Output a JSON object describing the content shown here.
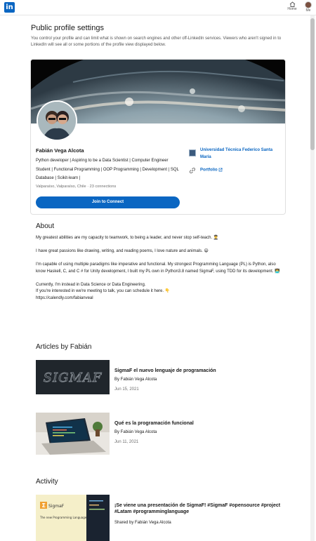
{
  "nav": {
    "logo_text": "in",
    "home_label": "Home",
    "me_label": "Me"
  },
  "settings": {
    "title": "Public profile settings",
    "description": "You control your profile and can limit what is shown on search engines and other off-LinkedIn services. Viewers who aren't signed in to LinkedIn will see all or some portions of the profile view displayed below."
  },
  "profile": {
    "name": "Fabián Vega Alcota",
    "headline": "Python developer | Aspiring to be a Data Scientist | Computer Engineer Student | Functional Programming | OOP Programming | Development | SQL Database | Scikit-learn |",
    "location": "Valparaíso, Valparaíso, Chile",
    "connections": "23 connections",
    "join_button": "Join to Connect",
    "education": "Universidad Técnica Federico Santa María",
    "portfolio_label": "Portfolio"
  },
  "about": {
    "title": "About",
    "paragraphs": [
      "My greatest abilities are my capacity to teamwork, to being a leader, and never stop self-teach. 👨‍🎓",
      "I have great passions like drawing, writing, and reading poems, I love nature and animals. 😄",
      "I'm capable of using multiple paradigms like imperative and functional. My strongest Programming Language (PL) is Python, also know Haskell, C, and C # for Unity development, I built my PL own in Python3.8 named SigmaF, using TDD for its development. 👨‍💻",
      "Currently, I'm instead in Data Science or Data Engineering.",
      "If you're interested in we're meeting to talk, you can schedule it here. 👇",
      "https://calendly.com/fabianveal"
    ]
  },
  "articles": {
    "title": "Articles by Fabián",
    "items": [
      {
        "title": "SigmaF el nuevo lenguaje de programación",
        "author": "By Fabián Vega Alcota",
        "date": "Jun 15, 2021",
        "thumb_text": "SIGMAF"
      },
      {
        "title": "Qué es la programación funcional",
        "author": "By Fabián Vega Alcota",
        "date": "Jun 11, 2021"
      }
    ]
  },
  "activity": {
    "title": "Activity",
    "items": [
      {
        "title": "¡Se viene una presentación de SigmaF! #SigmaF #opensource #project #Latam #programminglanguage",
        "author": "Shared by Fabián Vega Alcota",
        "thumb_brand": "SigmaF",
        "thumb_caption": "The new Programming Language"
      }
    ]
  },
  "colors": {
    "brand": "#0a66c2",
    "text": "#000000e6",
    "muted": "#00000099"
  }
}
